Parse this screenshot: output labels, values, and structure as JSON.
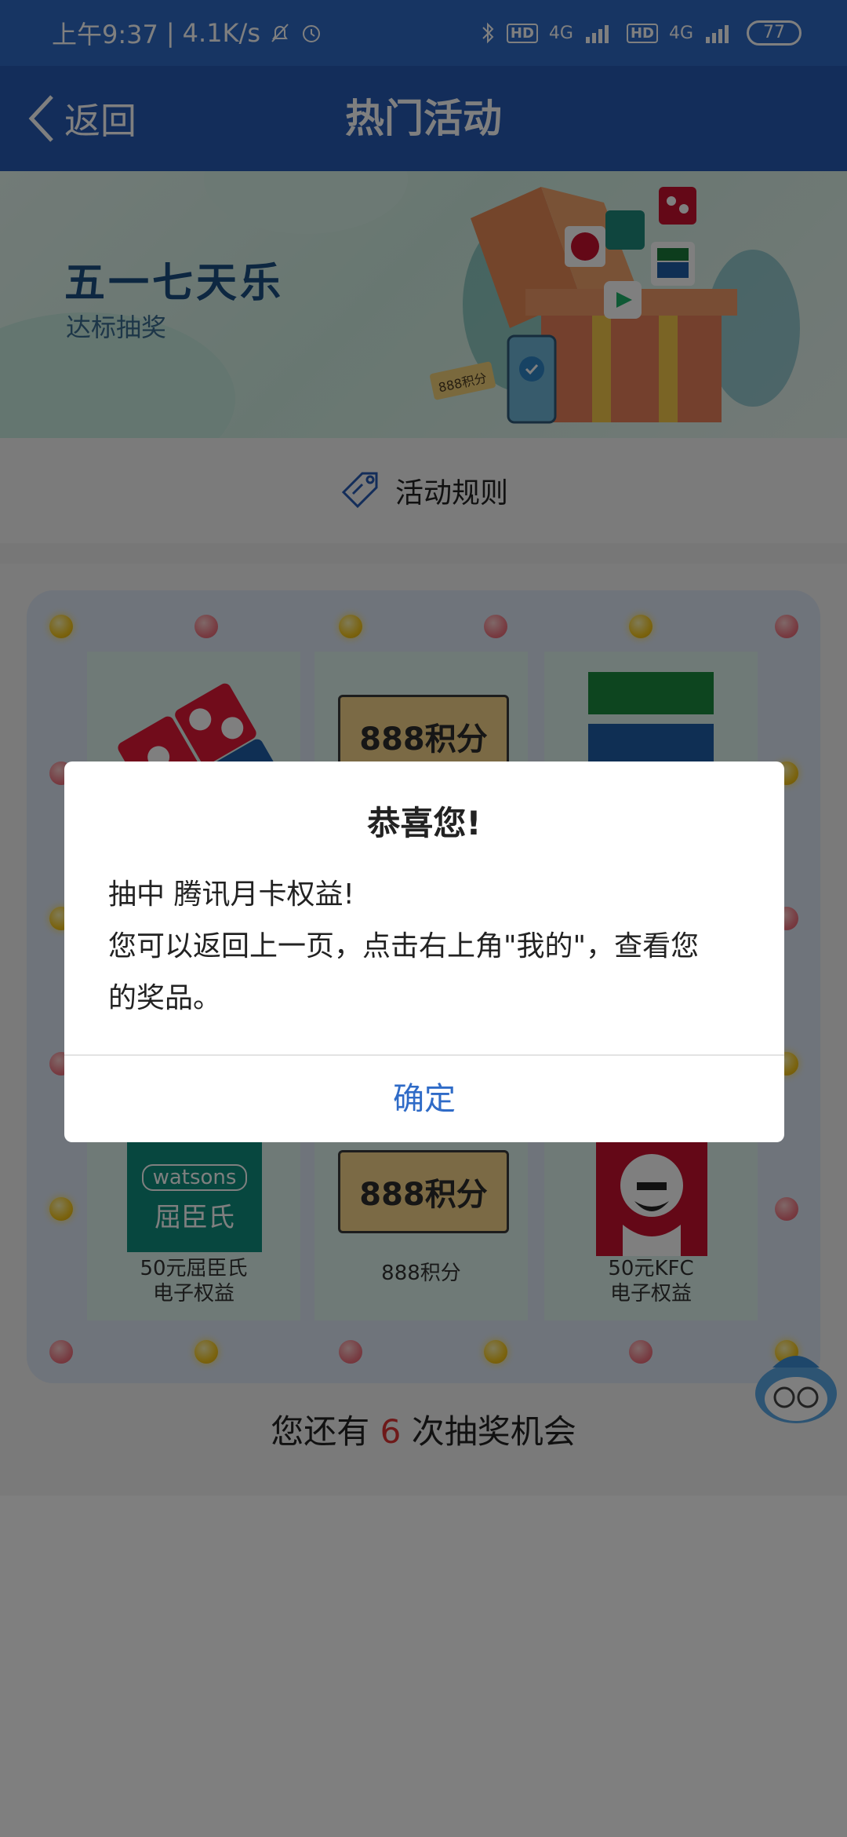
{
  "status_bar": {
    "time": "上午9:37",
    "speed": "4.1K/s",
    "hd_1": "HD",
    "net_1": "4G",
    "hd_2": "HD",
    "net_2": "4G",
    "battery": "77"
  },
  "nav": {
    "back_label": "返回",
    "title": "热门活动"
  },
  "banner": {
    "title": "五一七天乐",
    "subtitle": "达标抽奖",
    "tag_points": "888积分"
  },
  "rules": {
    "label": "活动规则"
  },
  "prizes": {
    "top_middle_ticket": "888积分",
    "bottom_left_brand": "watsons",
    "bottom_left_brand_cn": "屈臣氏",
    "bottom_left_label_1": "50元屈臣氏",
    "bottom_left_label_2": "电子权益",
    "bottom_middle_ticket": "888积分",
    "bottom_middle_label": "888积分",
    "bottom_right_label_1": "50元KFC",
    "bottom_right_label_2": "电子权益"
  },
  "remaining": {
    "prefix": "您还有",
    "count": "6",
    "suffix": "次抽奖机会"
  },
  "dialog": {
    "title": "恭喜您!",
    "line1": "抽中 腾讯月卡权益!",
    "line2": "您可以返回上一页，点击右上角\"我的\"，查看您",
    "line3": "的奖品。",
    "confirm": "确定"
  },
  "colors": {
    "status_bar": "#2f6bc7",
    "nav_bar": "#265ab4",
    "accent": "#2f6bc7",
    "highlight_count": "#d33333"
  }
}
